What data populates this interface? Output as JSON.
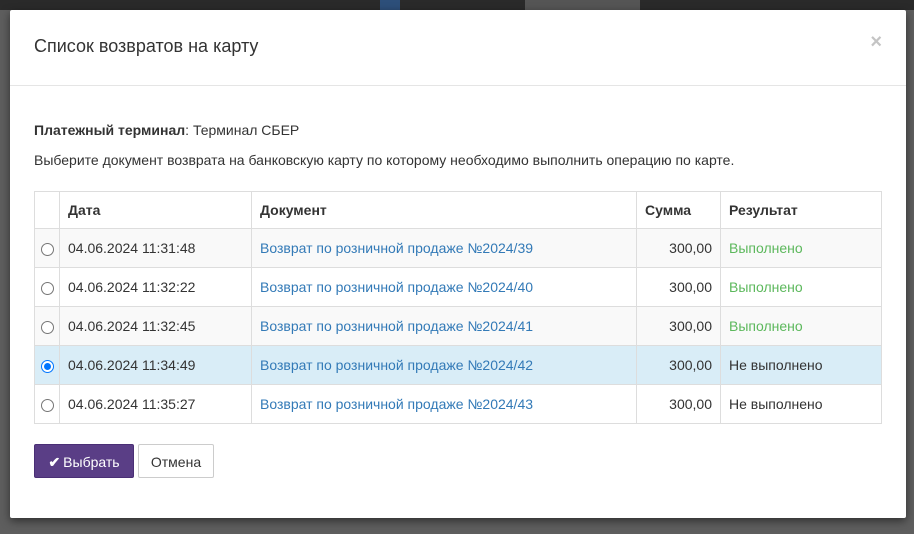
{
  "modal": {
    "title": "Список возвратов на карту",
    "close_label": "×"
  },
  "terminal": {
    "label": "Платежный терминал",
    "separator": ":",
    "value": "Терминал СБЕР"
  },
  "instruction": "Выберите документ возврата на банковскую карту по которому необходимо выполнить операцию по карте.",
  "table": {
    "headers": [
      "",
      "Дата",
      "Документ",
      "Сумма",
      "Результат"
    ],
    "rows": [
      {
        "selected": false,
        "date": "04.06.2024 11:31:48",
        "document": "Возврат по розничной продаже №2024/39",
        "sum": "300,00",
        "result": "Выполнено",
        "done": true
      },
      {
        "selected": false,
        "date": "04.06.2024 11:32:22",
        "document": "Возврат по розничной продаже №2024/40",
        "sum": "300,00",
        "result": "Выполнено",
        "done": true
      },
      {
        "selected": false,
        "date": "04.06.2024 11:32:45",
        "document": "Возврат по розничной продаже №2024/41",
        "sum": "300,00",
        "result": "Выполнено",
        "done": true
      },
      {
        "selected": true,
        "date": "04.06.2024 11:34:49",
        "document": "Возврат по розничной продаже №2024/42",
        "sum": "300,00",
        "result": "Не выполнено",
        "done": false
      },
      {
        "selected": false,
        "date": "04.06.2024 11:35:27",
        "document": "Возврат по розничной продаже №2024/43",
        "sum": "300,00",
        "result": "Не выполнено",
        "done": false
      }
    ]
  },
  "buttons": {
    "select_label": "Выбрать",
    "select_icon": "check-icon",
    "cancel_label": "Отмена"
  },
  "colors": {
    "primary_button": "#5a3e86",
    "link": "#337ab7",
    "status_done": "#5cb85c",
    "selected_row": "#d9edf7"
  }
}
